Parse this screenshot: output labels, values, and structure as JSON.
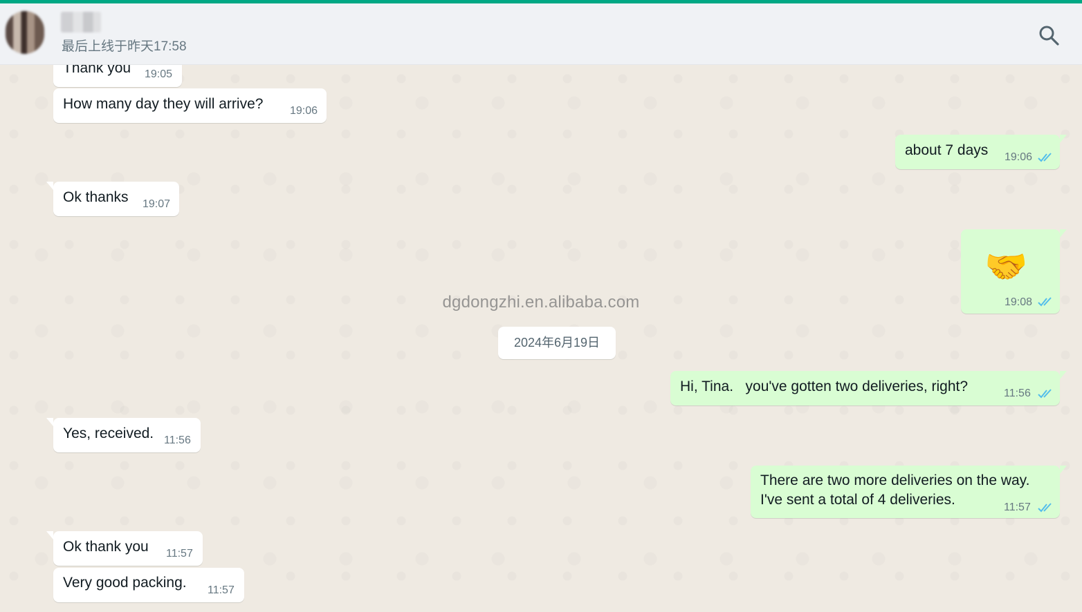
{
  "header": {
    "status": "最后上线于昨天17:58"
  },
  "watermark": "dgdongzhi.en.alibaba.com",
  "messages": [
    {
      "text": "Thank you",
      "time": "19:05"
    },
    {
      "text": "How many day they will arrive?",
      "time": "19:06"
    },
    {
      "text": "about 7 days",
      "time": "19:06"
    },
    {
      "text": "Ok thanks",
      "time": "19:07"
    },
    {
      "text": "🤝",
      "time": "19:08"
    },
    {
      "text": "Hi, Tina.   you've gotten two deliveries, right?",
      "time": "11:56"
    },
    {
      "text": "Yes, received.",
      "time": "11:56"
    },
    {
      "text_line1": "There are two more deliveries on the way.",
      "text_line2": "I've sent a total of 4 deliveries.",
      "time": "11:57"
    },
    {
      "text": "Ok thank you",
      "time": "11:57"
    },
    {
      "text": "Very good packing.",
      "time": "11:57"
    }
  ],
  "date_divider": "2024年6月19日",
  "colors": {
    "accent": "#00a884",
    "outgoing_bubble": "#d9fdd3",
    "incoming_bubble": "#ffffff",
    "read_ticks": "#53bdeb",
    "chat_background": "#efeae2"
  }
}
